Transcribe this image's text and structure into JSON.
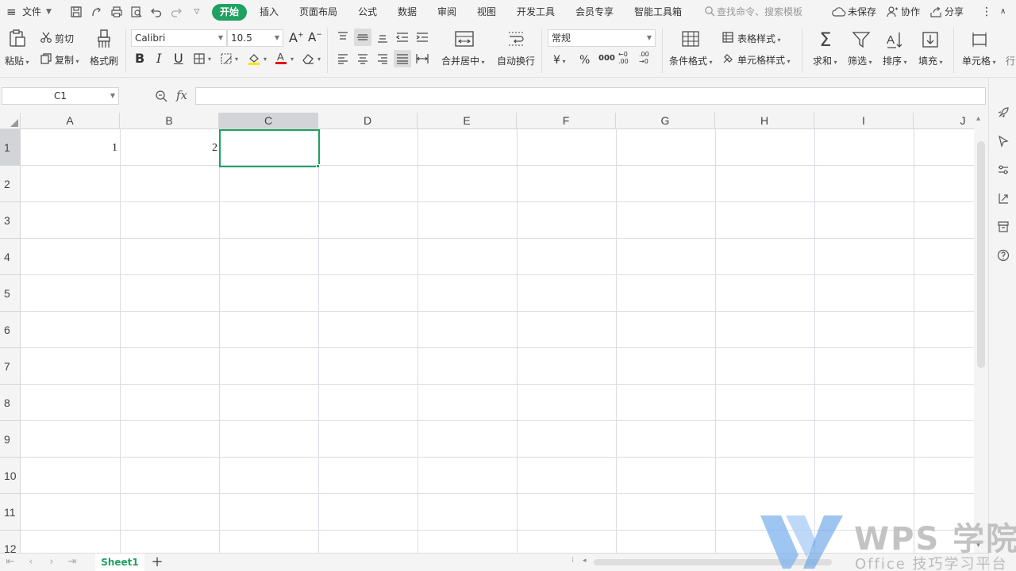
{
  "menubar": {
    "menu_label": "≡",
    "file_label": "文件",
    "tabs": [
      {
        "label": "开始"
      },
      {
        "label": "插入"
      },
      {
        "label": "页面布局"
      },
      {
        "label": "公式"
      },
      {
        "label": "数据"
      },
      {
        "label": "审阅"
      },
      {
        "label": "视图"
      },
      {
        "label": "开发工具"
      },
      {
        "label": "会员专享"
      },
      {
        "label": "智能工具箱"
      }
    ],
    "search_placeholder": "查找命令、搜索模板",
    "unsaved_label": "未保存",
    "collab_label": "协作",
    "share_label": "分享"
  },
  "ribbon": {
    "paste": "粘贴",
    "cut": "剪切",
    "copy": "复制",
    "format_painter": "格式刷",
    "font_name": "Calibri",
    "font_size": "10.5",
    "bold": "B",
    "italic": "I",
    "underline": "U",
    "merge_center": "合并居中",
    "wrap_text": "自动换行",
    "number_format": "常规",
    "currency": "¥",
    "percent": "%",
    "thousands": "000",
    "inc_decimal": "←0 .00",
    "dec_decimal": ".00 →0",
    "conditional_format": "条件格式",
    "table_style": "表格样式",
    "cell_style": "单元格样式",
    "sum": "求和",
    "filter": "筛选",
    "sort": "排序",
    "fill": "填充",
    "cell": "单元格",
    "row_col": "行"
  },
  "formula_bar": {
    "name_box": "C1",
    "fx": "fx",
    "value": ""
  },
  "grid": {
    "columns": [
      "A",
      "B",
      "C",
      "D",
      "E",
      "F",
      "G",
      "H",
      "I",
      "J"
    ],
    "rows": [
      "1",
      "2",
      "3",
      "4",
      "5",
      "6",
      "7",
      "8",
      "9",
      "10",
      "11",
      "12"
    ],
    "cells": {
      "A1": "1",
      "B1": "2"
    },
    "selected": "C1"
  },
  "sheetbar": {
    "sheet_name": "Sheet1",
    "add": "+"
  },
  "watermark": {
    "brand": "WPS 学院",
    "subtitle": "Office 技巧学习平台"
  },
  "colors": {
    "accent": "#1fa161",
    "font_color": "#e60012",
    "fill_color": "#ffe100"
  }
}
